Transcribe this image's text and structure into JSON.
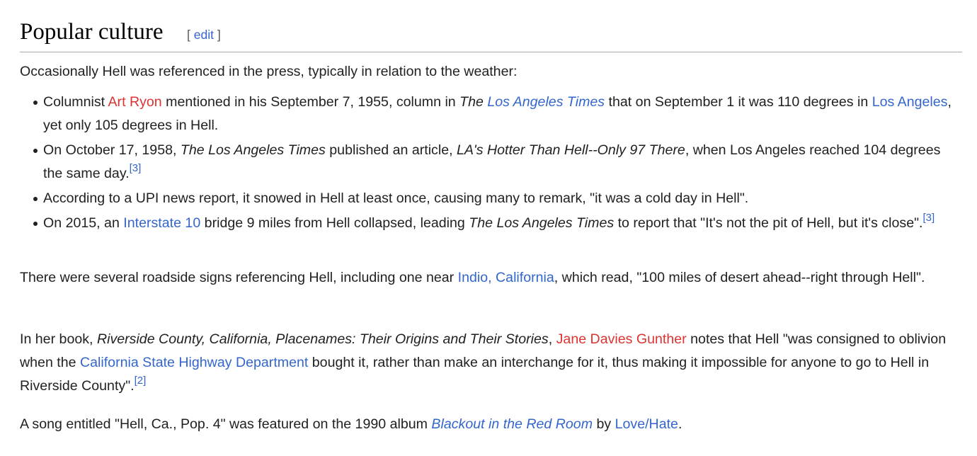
{
  "heading": {
    "title": "Popular culture",
    "edit_open": "[",
    "edit_label": "edit",
    "edit_close": "]"
  },
  "intro": "Occasionally Hell was referenced in the press, typically in relation to the weather:",
  "bullets": {
    "b1": {
      "t1": "Columnist ",
      "link_art_ryon": "Art Ryon",
      "t2": " mentioned in his September 7, 1955, column in ",
      "the": "The",
      "space": " ",
      "link_lat": "Los Angeles Times",
      "t3": " that on September 1 it was 110 degrees in ",
      "link_la": "Los Angeles",
      "t4": ", yet only 105 degrees in Hell."
    },
    "b2": {
      "t1": "On October 17, 1958, ",
      "lat": "The Los Angeles Times",
      "t2": " published an article, ",
      "article": "LA's Hotter Than Hell--Only 97 There",
      "t3": ", when Los Angeles reached 104 degrees the same day.",
      "ref": "[3]"
    },
    "b3": {
      "t1": "According to a UPI news report, it snowed in Hell at least once, causing many to remark, \"it was a cold day in Hell\"."
    },
    "b4": {
      "t1": "On 2015, an ",
      "link_i10": "Interstate 10",
      "t2": " bridge 9 miles from Hell collapsed, leading ",
      "lat": "The Los Angeles Times",
      "t3": " to report that \"It's not the pit of Hell, but it's close\".",
      "ref": "[3]"
    }
  },
  "signs": {
    "t1": "There were several roadside signs referencing Hell, including one near ",
    "link_indio": "Indio, California",
    "t2": ", which read, \"100 miles of desert ahead--right through Hell\"."
  },
  "book": {
    "t1": "In her book, ",
    "title": "Riverside County, California, Placenames: Their Origins and Their Stories",
    "t2": ", ",
    "link_author": "Jane Davies Gunther",
    "t3": " notes that Hell \"was consigned to oblivion when the ",
    "link_cshd": "California State Highway Department",
    "t4": " bought it, rather than make an interchange for it, thus making it impossible for anyone to go to Hell in Riverside County\".",
    "ref": "[2]"
  },
  "song": {
    "t1": "A song entitled \"Hell, Ca., Pop. 4\" was featured on the 1990 album ",
    "link_album": "Blackout in the Red Room",
    "t2": " by ",
    "link_band": "Love/Hate",
    "t3": "."
  },
  "colors": {
    "link": "#3366cc",
    "redlink": "#dd3333",
    "text": "#202122",
    "rule": "#a2a9b1"
  }
}
